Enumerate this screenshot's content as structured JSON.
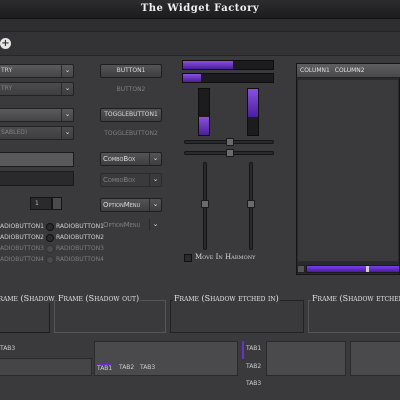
{
  "window": {
    "title": "The Widget Factory"
  },
  "toolbar": {
    "add_symbol": "+"
  },
  "left_column": {
    "combo_entry_1": "TRY",
    "combo_entry_2": "TRY",
    "combo_3": "",
    "combo_disabled": "SABLED)",
    "spin_value": "1",
    "radio_col1": [
      "ADIOBUTTON1",
      "ADIOBUTTON2",
      "ADIOBUTTON3",
      "ADIOBUTTON4"
    ],
    "radio_col2": [
      "RADIOBUTTON1",
      "RADIOBUTTON2",
      "RADIOBUTTON3",
      "RADIOBUTTON4"
    ]
  },
  "buttons": {
    "button1": "BUTTON1",
    "button2": "BUTTON2",
    "toggle1": "TOGGLEBUTTON1",
    "toggle2": "TOGGLEBUTTON2",
    "combobox": "ComboBox",
    "combobox_disabled": "ComboBox",
    "optionmenu": "OptionMenu",
    "optionmenu_disabled": "OptionMenu"
  },
  "scales": {
    "hprog1": 0.55,
    "hprog2": 0.2,
    "vprog1": 0.4,
    "vprog2": 0.6,
    "move_in_harmony": "Move In Harmony"
  },
  "tree": {
    "columns": [
      "COLUMN1",
      "COLUMN2"
    ]
  },
  "frames": {
    "frame1": "Frame (Shadow in)",
    "frame2": "Frame (Shadow out)",
    "frame3": "Frame (Shadow etched in)",
    "frame4": "Frame (Shadow etched out)"
  },
  "notebooks": {
    "nb1_tab": "TAB3",
    "nb2_tabs": [
      "TAB1",
      "TAB2",
      "TAB3"
    ],
    "nb3_tabs": [
      "TAB1",
      "TAB2",
      "TAB3"
    ]
  },
  "colors": {
    "accent": "#6a2fd0",
    "background": "#3a3a3c"
  }
}
